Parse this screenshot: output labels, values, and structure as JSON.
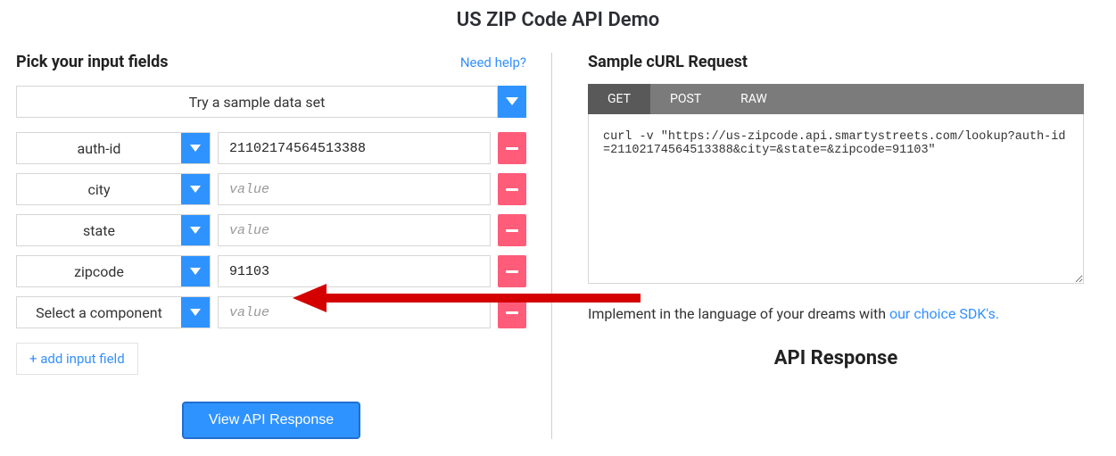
{
  "page_title": "US ZIP Code API Demo",
  "left": {
    "heading": "Pick your input fields",
    "help_link": "Need help?",
    "sample_placeholder": "Try a sample data set",
    "fields": [
      {
        "name": "auth-id",
        "value": "21102174564513388",
        "placeholder": "value"
      },
      {
        "name": "city",
        "value": "",
        "placeholder": "value"
      },
      {
        "name": "state",
        "value": "",
        "placeholder": "value"
      },
      {
        "name": "zipcode",
        "value": "91103",
        "placeholder": "value"
      },
      {
        "name": "Select a component",
        "value": "",
        "placeholder": "value"
      }
    ],
    "add_field_label": "+ add input field",
    "view_response_label": "View API Response"
  },
  "right": {
    "heading": "Sample cURL Request",
    "tabs": [
      "GET",
      "POST",
      "RAW"
    ],
    "active_tab": 0,
    "curl_text": "curl -v \"https://us-zipcode.api.smartystreets.com/lookup?auth-id=21102174564513388&city=&state=&zipcode=91103\"",
    "implement_prefix": "Implement in the language of your dreams with ",
    "sdk_link_text": "our choice SDK's.",
    "api_response_heading": "API Response"
  }
}
